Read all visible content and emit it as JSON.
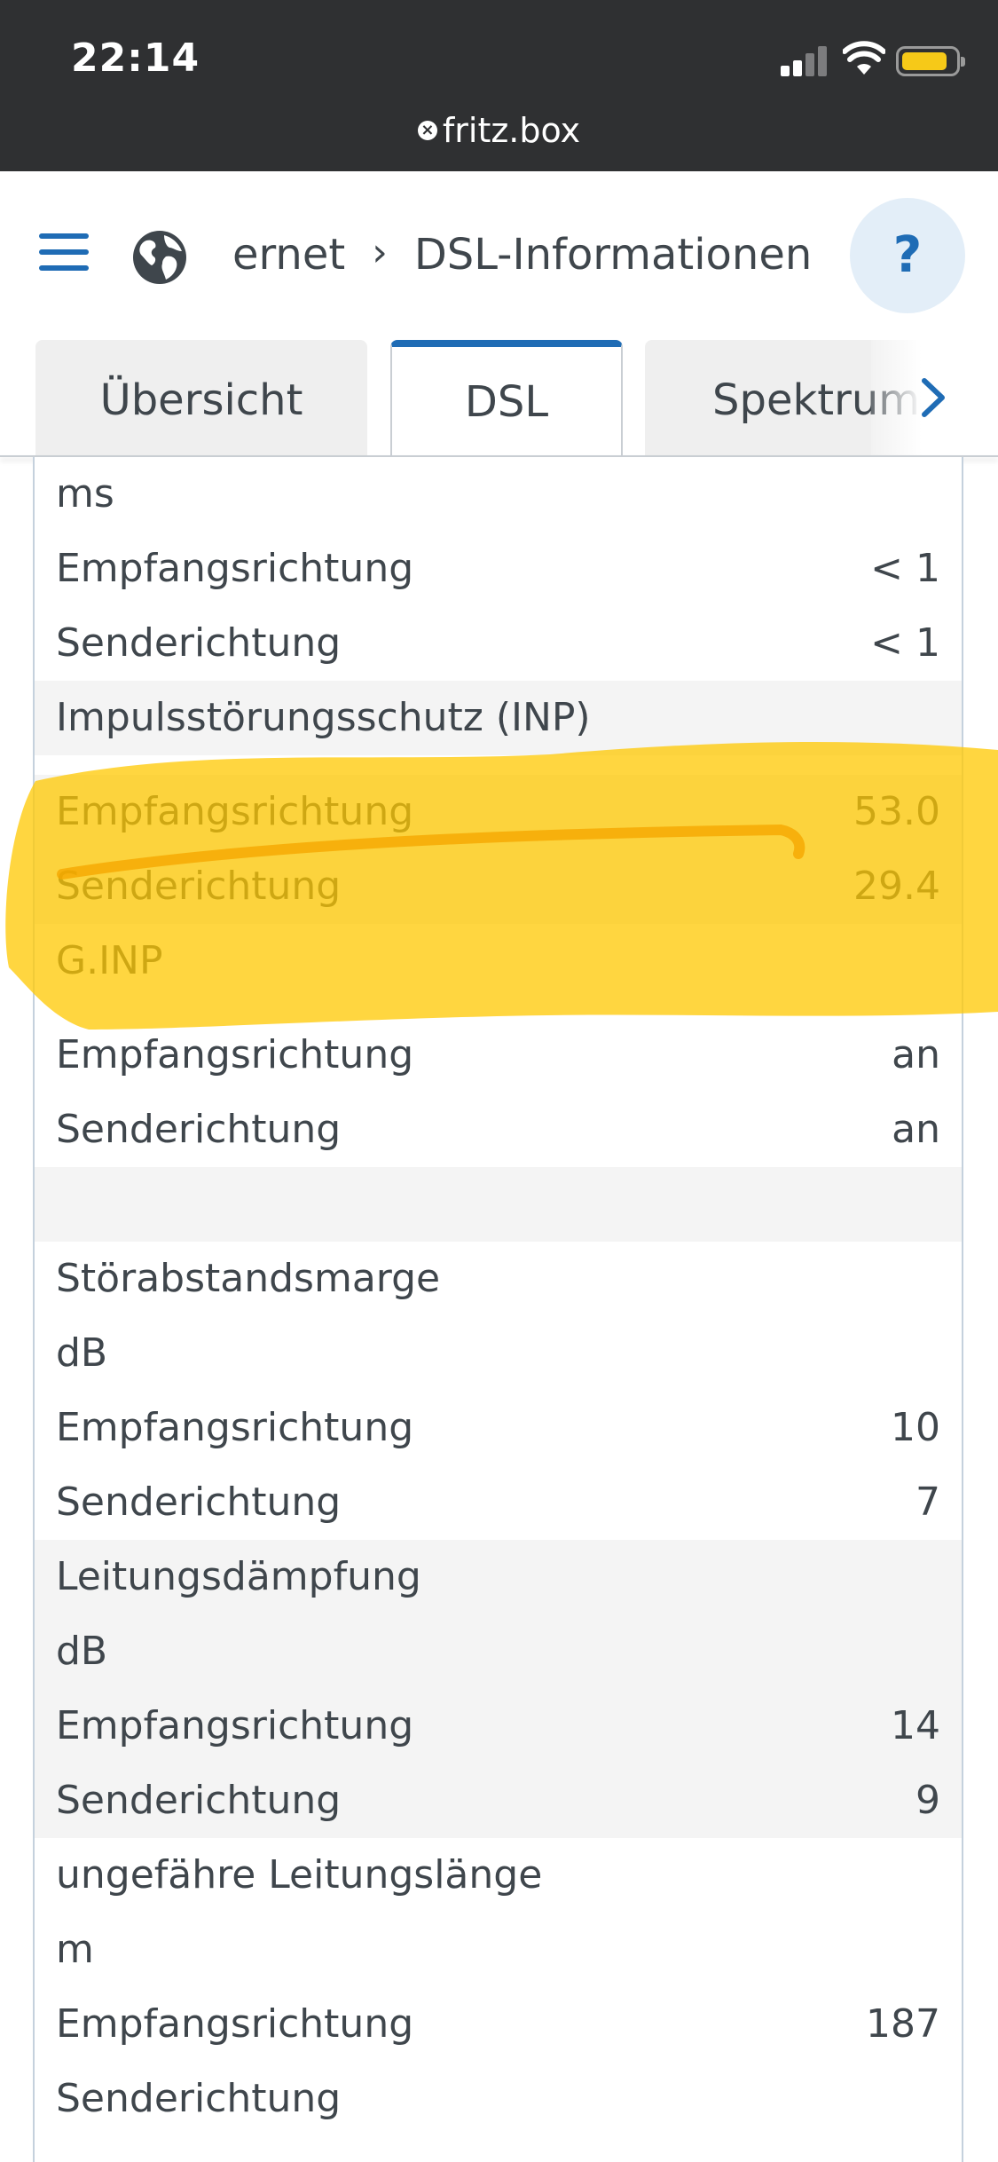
{
  "status_bar": {
    "time": "22:14",
    "url": "fritz.box",
    "url_icon": "×"
  },
  "header": {
    "breadcrumb_parent": "ernet",
    "breadcrumb_separator": "›",
    "breadcrumb_current": "DSL-Informationen",
    "help_label": "?"
  },
  "tabs": {
    "items": [
      {
        "label": "Übersicht"
      },
      {
        "label": "DSL"
      },
      {
        "label": "Spektrum"
      }
    ],
    "active": "DSL"
  },
  "rows": [
    {
      "label": "ms",
      "value": ""
    },
    {
      "label": "Empfangsrichtung",
      "value": "< 1"
    },
    {
      "label": "Senderichtung",
      "value": "< 1"
    },
    {
      "label": "Impulsstörungsschutz (INP)",
      "value": ""
    },
    {
      "label": "Empfangsrichtung",
      "value": "53.0"
    },
    {
      "label": "Senderichtung",
      "value": "29.4"
    },
    {
      "label": "G.INP",
      "value": ""
    },
    {
      "label": "Empfangsrichtung",
      "value": "an"
    },
    {
      "label": "Senderichtung",
      "value": "an"
    },
    {
      "label": "",
      "value": ""
    },
    {
      "label": "Störabstandsmarge",
      "value": ""
    },
    {
      "label": "dB",
      "value": ""
    },
    {
      "label": "Empfangsrichtung",
      "value": "10"
    },
    {
      "label": "Senderichtung",
      "value": "7"
    },
    {
      "label": "Leitungsdämpfung",
      "value": ""
    },
    {
      "label": "dB",
      "value": ""
    },
    {
      "label": "Empfangsrichtung",
      "value": "14"
    },
    {
      "label": "Senderichtung",
      "value": "9"
    },
    {
      "label": "ungefähre Leitungslänge",
      "value": ""
    },
    {
      "label": "m",
      "value": ""
    },
    {
      "label": "Empfangsrichtung",
      "value": "187"
    },
    {
      "label": "Senderichtung",
      "value": ""
    }
  ],
  "colors": {
    "accent": "#1f6cb5",
    "highlighter": "#ffc800",
    "status_bar": "#2f3032",
    "row_gray": "#f4f4f4",
    "text": "#3f464c"
  },
  "icons": {
    "menu": "menu-icon",
    "globe": "globe-icon",
    "tab_next": "chevron-right-icon",
    "signal": "signal-icon",
    "wifi": "wifi-icon",
    "battery": "battery-icon"
  }
}
